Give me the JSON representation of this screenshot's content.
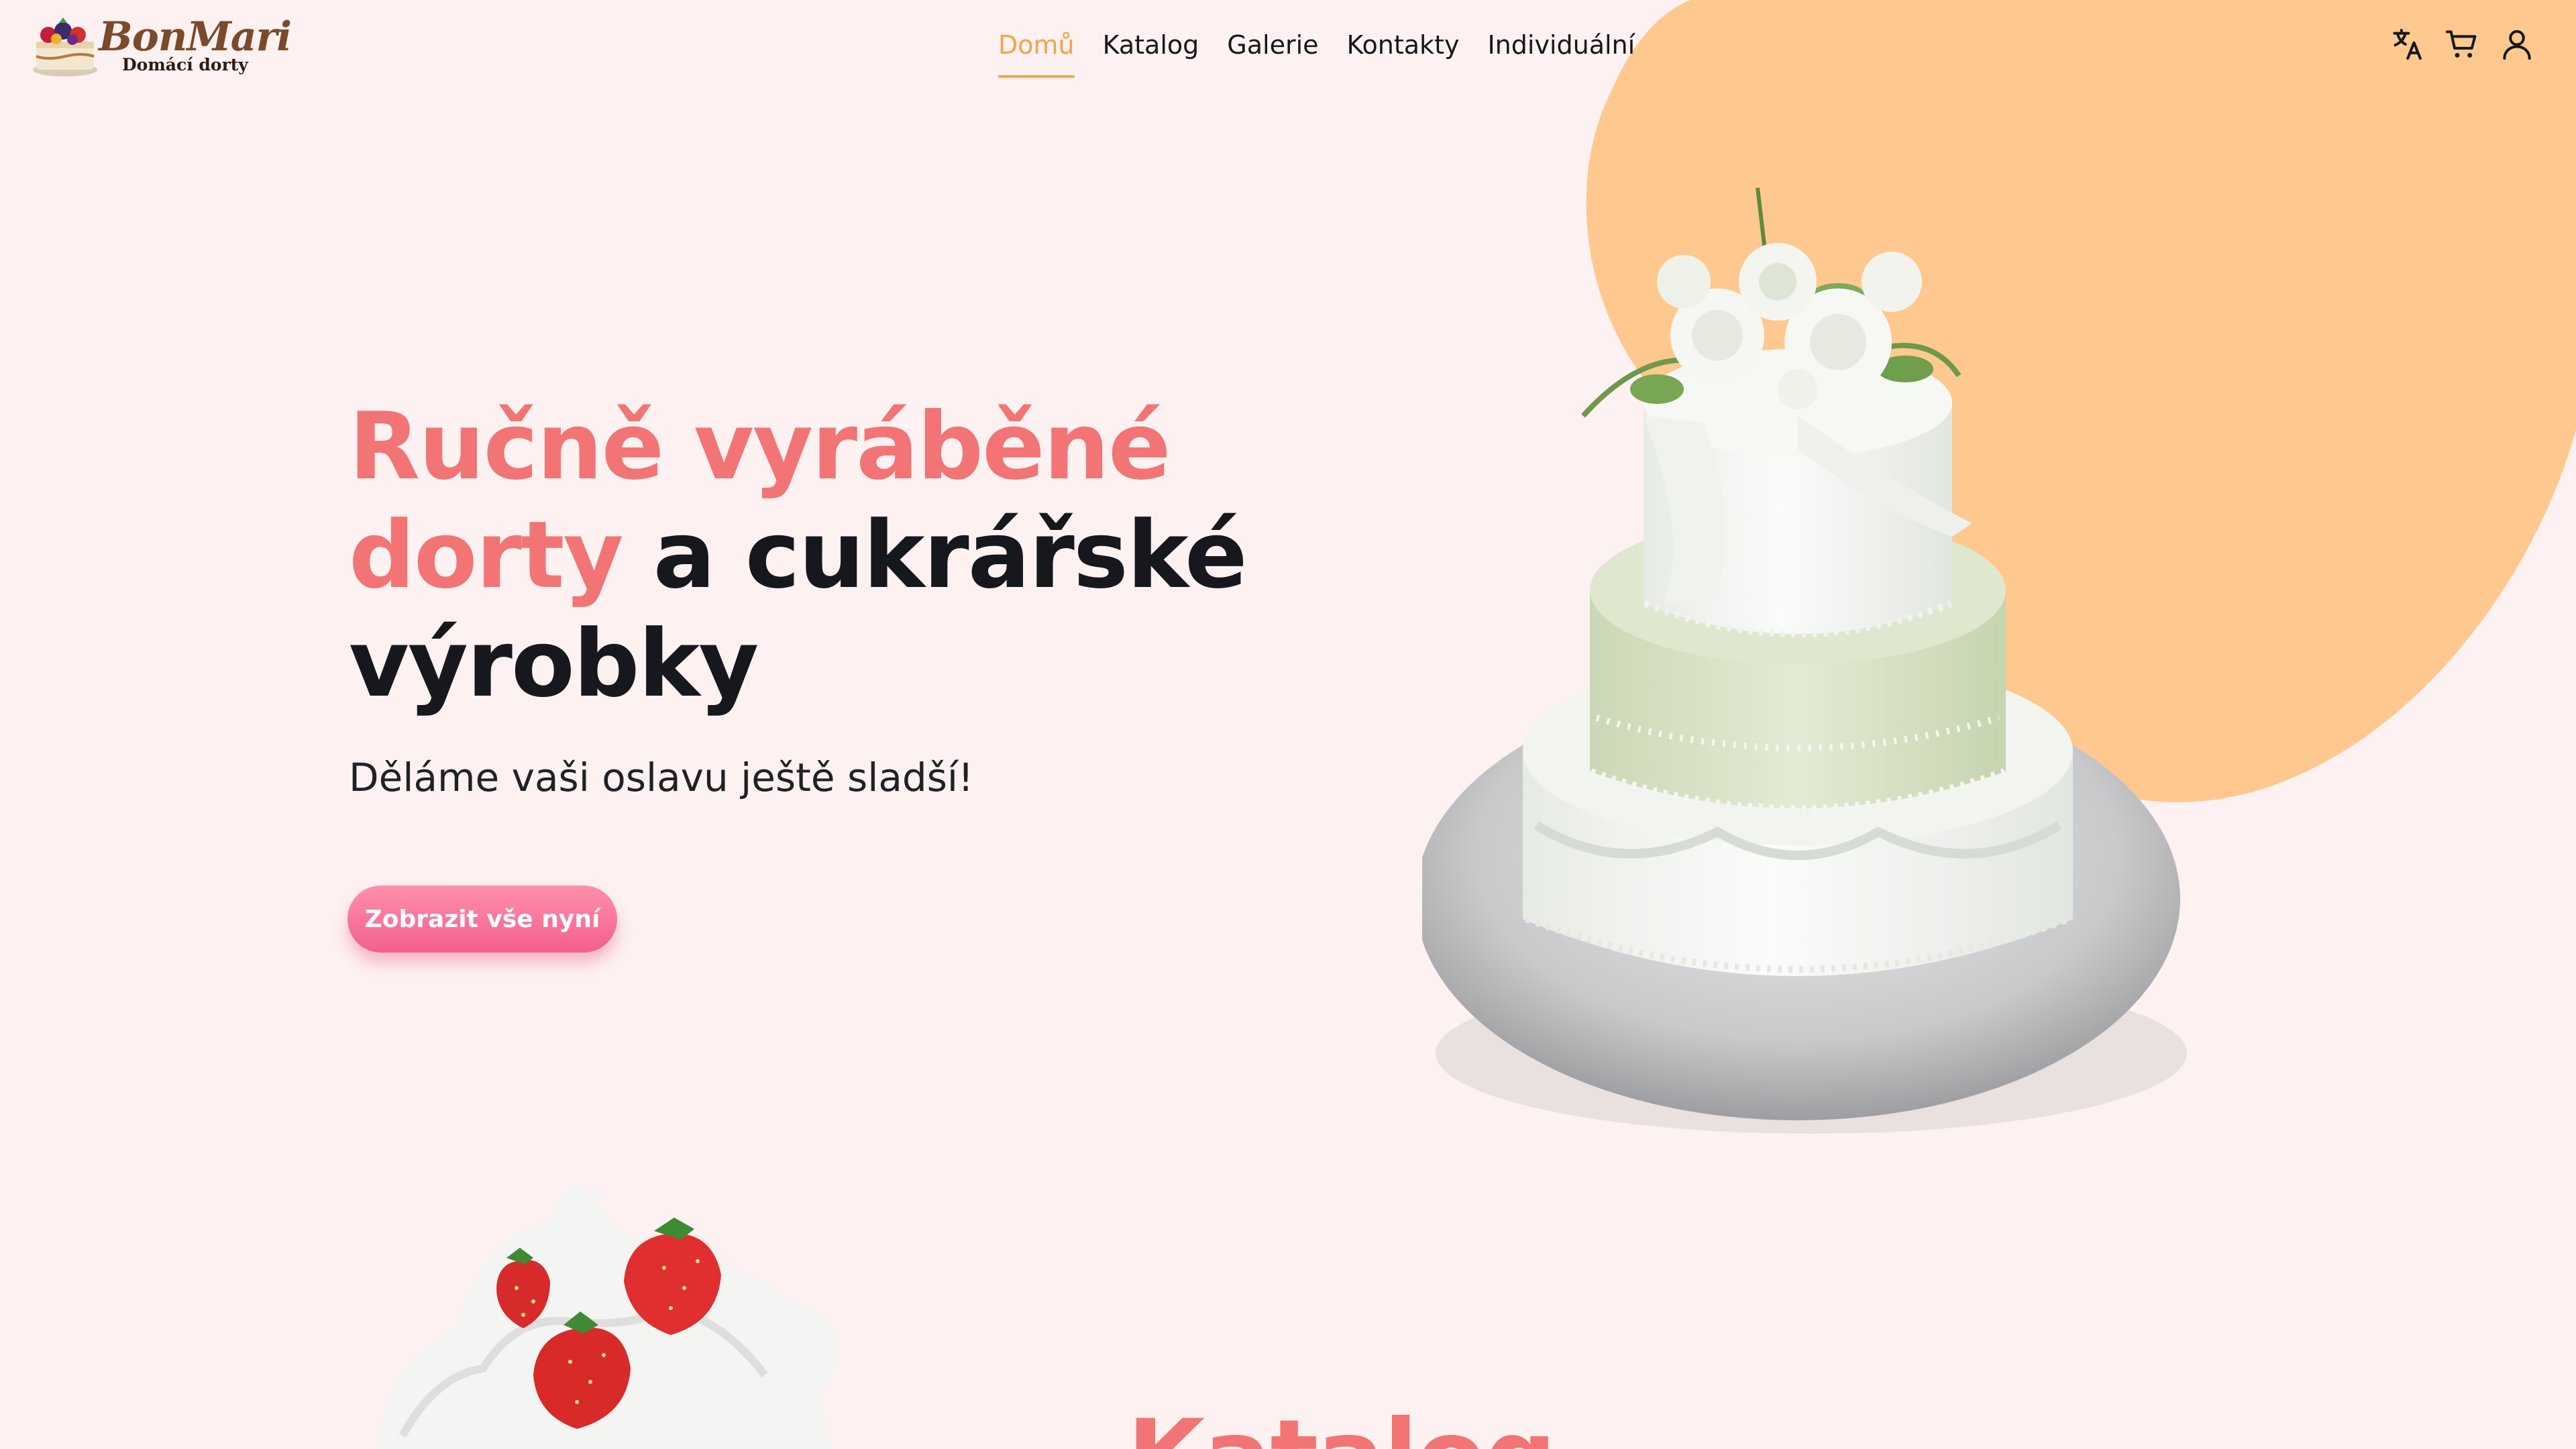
{
  "brand": {
    "name": "BonMari",
    "tagline": "Domácí dorty"
  },
  "nav": {
    "items": [
      {
        "label": "Domů",
        "active": true
      },
      {
        "label": "Katalog",
        "active": false
      },
      {
        "label": "Galerie",
        "active": false
      },
      {
        "label": "Kontakty",
        "active": false
      },
      {
        "label": "Individuální",
        "active": false
      }
    ]
  },
  "header_icons": [
    "translate-icon",
    "cart-icon",
    "user-icon"
  ],
  "hero": {
    "title_accent": "Ručně vyráběné dorty",
    "title_rest": " a cukrářské výrobky",
    "subtitle": "Děláme vaši oslavu ještě sladší!",
    "cta_label": "Zobrazit vše nyní"
  },
  "section": {
    "title": "Katalog"
  },
  "colors": {
    "background": "#fdf1f1",
    "accent": "#f27474",
    "nav_active": "#f6a24a",
    "blob": "#ffc88e",
    "button": "#f2608c",
    "text": "#16181d"
  }
}
